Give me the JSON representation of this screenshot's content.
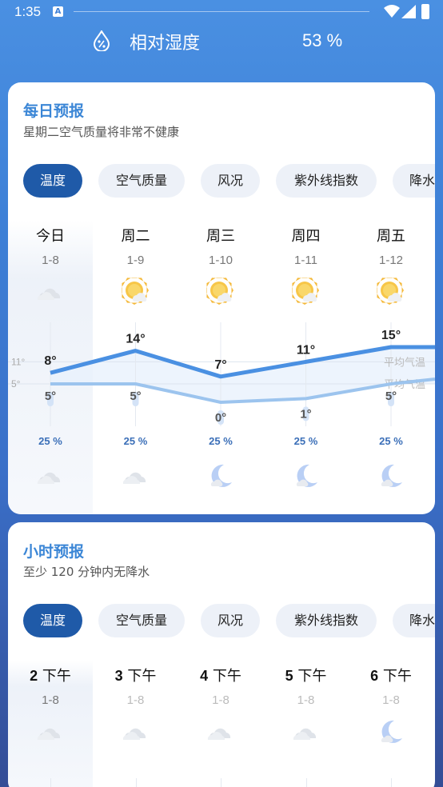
{
  "status": {
    "time": "1:35",
    "a_label": "A"
  },
  "humidity": {
    "label": "相对湿度",
    "value": "53 %"
  },
  "daily": {
    "title": "每日预报",
    "subtitle": "星期二空气质量将非常不健康",
    "chips": [
      "温度",
      "空气质量",
      "风况",
      "紫外线指数",
      "降水"
    ],
    "days": [
      {
        "name": "今日",
        "date": "1-8",
        "day_icon": "cloud-icon",
        "high": "8°",
        "low": "5°",
        "precip": "25 %",
        "night_icon": "cloud-icon"
      },
      {
        "name": "周二",
        "date": "1-9",
        "day_icon": "sun-cloud-icon",
        "high": "14°",
        "low": "5°",
        "precip": "25 %",
        "night_icon": "cloud-icon"
      },
      {
        "name": "周三",
        "date": "1-10",
        "day_icon": "sun-cloud-icon",
        "high": "7°",
        "low": "0°",
        "precip": "25 %",
        "night_icon": "moon-cloud-icon"
      },
      {
        "name": "周四",
        "date": "1-11",
        "day_icon": "sun-cloud-icon",
        "high": "11°",
        "low": "1°",
        "precip": "25 %",
        "night_icon": "moon-cloud-icon"
      },
      {
        "name": "周五",
        "date": "1-12",
        "day_icon": "sun-cloud-icon",
        "high": "15°",
        "low": "5°",
        "precip": "25 %",
        "night_icon": "moon-cloud-icon"
      }
    ],
    "axis": {
      "high_tick": "11°",
      "low_tick": "5°",
      "avg_high_label": "平均气温",
      "avg_low_label": "平均气温"
    },
    "high_values": [
      8,
      14,
      7,
      11,
      15
    ],
    "low_values": [
      5,
      5,
      0,
      1,
      5
    ]
  },
  "hourly": {
    "title": "小时预报",
    "subtitle": "至少 120 分钟内无降水",
    "chips": [
      "温度",
      "空气质量",
      "风况",
      "紫外线指数",
      "降水"
    ],
    "hours": [
      {
        "num": "2",
        "unit": "下午",
        "date": "1-8",
        "icon": "cloud-icon"
      },
      {
        "num": "3",
        "unit": "下午",
        "date": "1-8",
        "icon": "cloud-icon"
      },
      {
        "num": "4",
        "unit": "下午",
        "date": "1-8",
        "icon": "cloud-icon"
      },
      {
        "num": "5",
        "unit": "下午",
        "date": "1-8",
        "icon": "cloud-icon"
      },
      {
        "num": "6",
        "unit": "下午",
        "date": "1-8",
        "icon": "moon-cloud-icon"
      }
    ]
  },
  "colors": {
    "accent": "#3b86d6",
    "chip_active": "#1f5aa8",
    "line_high": "#4a90e2",
    "line_low": "#9cc4ee"
  }
}
